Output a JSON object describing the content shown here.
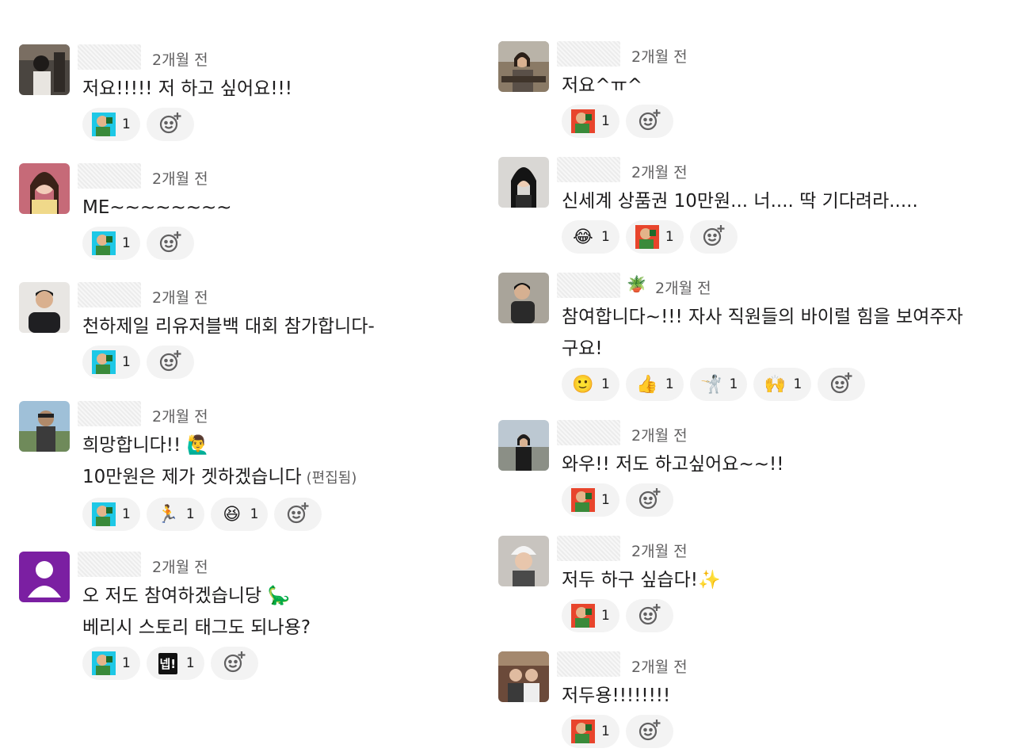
{
  "left": [
    {
      "time": "2개월 전",
      "lines": [
        "저요!!!!! 저 하고 싶어요!!!"
      ],
      "reactions": [
        {
          "icon": "custom-avatar-emoji-teal",
          "count": "1"
        }
      ]
    },
    {
      "time": "2개월 전",
      "lines": [
        "ME~~~~~~~~"
      ],
      "reactions": [
        {
          "icon": "custom-avatar-emoji-teal",
          "count": "1"
        }
      ]
    },
    {
      "time": "2개월 전",
      "lines": [
        "천하제일 리유저블백 대회 참가합니다-"
      ],
      "reactions": [
        {
          "icon": "custom-avatar-emoji-teal",
          "count": "1"
        }
      ]
    },
    {
      "time": "2개월 전",
      "lines": [
        "희망합니다!! 🙋‍♂️",
        "10만원은 제가 겟하겠습니다"
      ],
      "edited": "(편집됨)",
      "reactions": [
        {
          "icon": "custom-avatar-emoji-teal",
          "count": "1"
        },
        {
          "icon": "🏃",
          "count": "1"
        },
        {
          "icon": "😆",
          "count": "1"
        }
      ]
    },
    {
      "time": "2개월 전",
      "lines": [
        "오 저도 참여하겠습니당 🦕",
        "베리시 스토리 태그도 되나용?"
      ],
      "reactions": [
        {
          "icon": "custom-avatar-emoji-teal",
          "count": "1"
        },
        {
          "icon": "넵!",
          "count": "1"
        }
      ]
    }
  ],
  "right": [
    {
      "time": "2개월 전",
      "lines": [
        "저요^ㅠ^"
      ],
      "reactions": [
        {
          "icon": "custom-avatar-emoji-red",
          "count": "1"
        }
      ]
    },
    {
      "time": "2개월 전",
      "lines": [
        "신세계 상품권 10만원... 너.... 딱 기다려라....."
      ],
      "reactions": [
        {
          "icon": "😂",
          "count": "1"
        },
        {
          "icon": "custom-avatar-emoji-red",
          "count": "1"
        }
      ]
    },
    {
      "time": "2개월 전",
      "name_emoji": "🪴",
      "lines": [
        "참여합니다~!!! 자사 직원들의 바이럴 힘을 보여주자",
        "구요!"
      ],
      "reactions": [
        {
          "icon": "🙂",
          "count": "1"
        },
        {
          "icon": "👍",
          "count": "1"
        },
        {
          "icon": "🤺",
          "count": "1"
        },
        {
          "icon": "🙌",
          "count": "1"
        }
      ]
    },
    {
      "time": "2개월 전",
      "lines": [
        "와우!! 저도 하고싶어요~~!!"
      ],
      "reactions": [
        {
          "icon": "custom-avatar-emoji-red",
          "count": "1"
        }
      ]
    },
    {
      "time": "2개월 전",
      "lines": [
        "저두 하구 싶습다!✨"
      ],
      "reactions": [
        {
          "icon": "custom-avatar-emoji-red",
          "count": "1"
        }
      ]
    },
    {
      "time": "2개월 전",
      "lines": [
        "저두용!!!!!!!!"
      ],
      "reactions": [
        {
          "icon": "custom-avatar-emoji-red",
          "count": "1"
        }
      ]
    }
  ],
  "colors": {
    "pill_bg": "#f3f3f3",
    "time": "#616061",
    "default_avatar": "#7b1fa2"
  }
}
